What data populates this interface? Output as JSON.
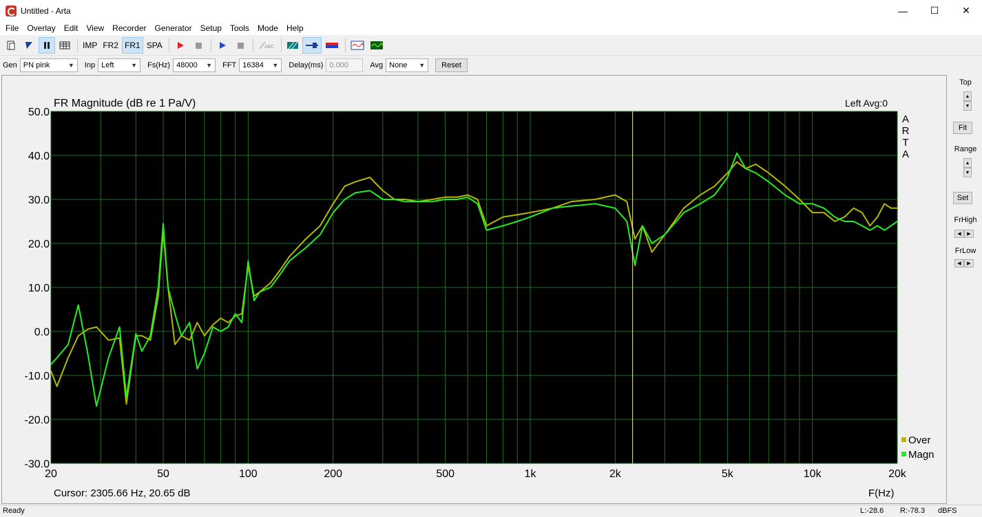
{
  "window": {
    "title": "Untitled - Arta",
    "minimize": "—",
    "maximize": "☐",
    "close": "✕"
  },
  "menu": [
    "File",
    "Overlay",
    "Edit",
    "View",
    "Recorder",
    "Generator",
    "Setup",
    "Tools",
    "Mode",
    "Help"
  ],
  "toolbar": {
    "imp": "IMP",
    "fr2": "FR2",
    "fr1": "FR1",
    "spa": "SPA",
    "icons": [
      "new-file-icon",
      "open-icon",
      "pause-icon",
      "table-icon",
      "record-icon",
      "stop-icon",
      "play-icon",
      "stop-gray-icon",
      "abc-icon",
      "hatch-icon",
      "slider-icon",
      "redblue-icon",
      "scope-red-icon",
      "scope-green-icon"
    ]
  },
  "params": {
    "gen_label": "Gen",
    "gen_value": "PN pink",
    "inp_label": "Inp",
    "inp_value": "Left",
    "fs_label": "Fs(Hz)",
    "fs_value": "48000",
    "fft_label": "FFT",
    "fft_value": "16384",
    "delay_label": "Delay(ms)",
    "delay_value": "0.000",
    "avg_label": "Avg",
    "avg_value": "None",
    "reset_label": "Reset"
  },
  "plot": {
    "title": "FR Magnitude (dB re 1 Pa/V)",
    "channel_info": "Left  Avg:0",
    "watermark": [
      "A",
      "R",
      "T",
      "A"
    ],
    "cursor_text": "Cursor: 2305.66 Hz, 20.65 dB",
    "xlabel": "F(Hz)",
    "legend": [
      {
        "name": "Over",
        "color": "#b8b800"
      },
      {
        "name": "Magn",
        "color": "#22ee22"
      }
    ]
  },
  "side": {
    "top_label": "Top",
    "fit_label": "Fit",
    "range_label": "Range",
    "set_label": "Set",
    "frhigh_label": "FrHigh",
    "frlow_label": "FrLow"
  },
  "status": {
    "ready": "Ready",
    "left": "L:-28.6",
    "right": "R:-78.3",
    "unit": "dBFS"
  },
  "chart_data": {
    "type": "line",
    "title": "FR Magnitude (dB re 1 Pa/V)",
    "xlabel": "F(Hz)",
    "ylabel": "",
    "xscale": "log",
    "xlim": [
      20,
      20000
    ],
    "ylim": [
      -30,
      50
    ],
    "xticks": [
      20,
      50,
      100,
      200,
      500,
      1000,
      2000,
      5000,
      10000,
      20000
    ],
    "xtick_labels": [
      "20",
      "50",
      "100",
      "200",
      "500",
      "1k",
      "2k",
      "5k",
      "10k",
      "20k"
    ],
    "yticks": [
      50,
      40,
      30,
      20,
      10,
      0,
      -10,
      -20,
      -30
    ],
    "ytick_labels": [
      "50.0",
      "40.0",
      "30.0",
      "20.0",
      "10.0",
      "0.0",
      "-10.0",
      "-20.0",
      "-30.0"
    ],
    "cursor_hz": 2305.66,
    "grid": true,
    "legend_position": "bottom-right",
    "series": [
      {
        "name": "Over",
        "color": "#b8b800",
        "x": [
          20,
          21,
          23,
          25,
          27,
          29,
          32,
          35,
          37,
          40,
          42,
          45,
          48,
          50,
          52,
          55,
          58,
          62,
          66,
          70,
          75,
          80,
          85,
          90,
          95,
          100,
          105,
          110,
          120,
          130,
          140,
          160,
          180,
          200,
          220,
          240,
          270,
          300,
          330,
          360,
          400,
          450,
          500,
          550,
          600,
          650,
          700,
          800,
          900,
          1000,
          1200,
          1400,
          1700,
          2000,
          2200,
          2350,
          2500,
          2700,
          3000,
          3500,
          4000,
          4500,
          5000,
          5400,
          5800,
          6300,
          7000,
          8000,
          9000,
          10000,
          11000,
          12000,
          13000,
          14000,
          15000,
          16000,
          17000,
          18000,
          19000,
          20000
        ],
        "y": [
          -9,
          -12.5,
          -6,
          -1,
          0.5,
          1,
          -2,
          -1.5,
          -16.5,
          -1,
          -1,
          -2,
          8,
          23,
          10,
          -3,
          -1,
          -2,
          2,
          -1,
          1.5,
          3,
          2,
          3.5,
          4,
          15,
          8,
          9,
          11,
          14,
          17,
          21,
          24,
          29,
          33,
          34,
          35,
          32,
          30,
          30,
          29.5,
          30,
          30.5,
          30.5,
          31,
          30,
          24,
          26,
          26.5,
          27,
          28,
          29.5,
          30,
          31,
          29.5,
          21,
          24,
          18,
          22,
          28,
          31,
          33,
          36,
          38.5,
          37,
          38,
          36,
          33,
          30,
          27,
          27,
          25,
          26,
          28,
          27,
          24,
          26,
          29,
          28,
          28
        ]
      },
      {
        "name": "Magn",
        "color": "#22ee22",
        "x": [
          20,
          21,
          23,
          25,
          27,
          29,
          32,
          35,
          37,
          40,
          42,
          45,
          48,
          50,
          52,
          55,
          58,
          62,
          66,
          70,
          75,
          80,
          85,
          90,
          95,
          100,
          105,
          110,
          120,
          130,
          140,
          160,
          180,
          200,
          220,
          240,
          270,
          300,
          330,
          360,
          400,
          450,
          500,
          550,
          600,
          650,
          700,
          800,
          900,
          1000,
          1200,
          1400,
          1700,
          2000,
          2200,
          2350,
          2500,
          2700,
          3000,
          3500,
          4000,
          4500,
          5000,
          5400,
          5800,
          6300,
          7000,
          8000,
          9000,
          10000,
          11000,
          12000,
          13000,
          14000,
          15000,
          16000,
          17000,
          18000,
          19000,
          20000
        ],
        "y": [
          -7.5,
          -6,
          -3,
          6,
          -5,
          -17,
          -6,
          1,
          -15,
          -0.5,
          -4.5,
          -1,
          10,
          24.5,
          10,
          4,
          -1,
          2,
          -8.5,
          -5,
          1,
          0,
          1,
          4,
          2,
          16,
          7,
          9,
          10,
          13,
          16,
          19,
          22,
          27,
          30,
          31.5,
          32,
          30,
          30,
          29.5,
          29.5,
          29.5,
          30,
          30,
          30.5,
          29,
          23,
          24,
          25,
          26,
          28,
          28.5,
          29,
          28,
          25,
          15,
          24,
          20,
          22,
          27,
          29,
          31,
          35,
          40.5,
          37,
          36,
          34,
          31,
          29,
          29,
          28,
          26,
          25,
          25,
          24,
          23,
          24,
          23,
          24,
          25
        ]
      }
    ]
  }
}
